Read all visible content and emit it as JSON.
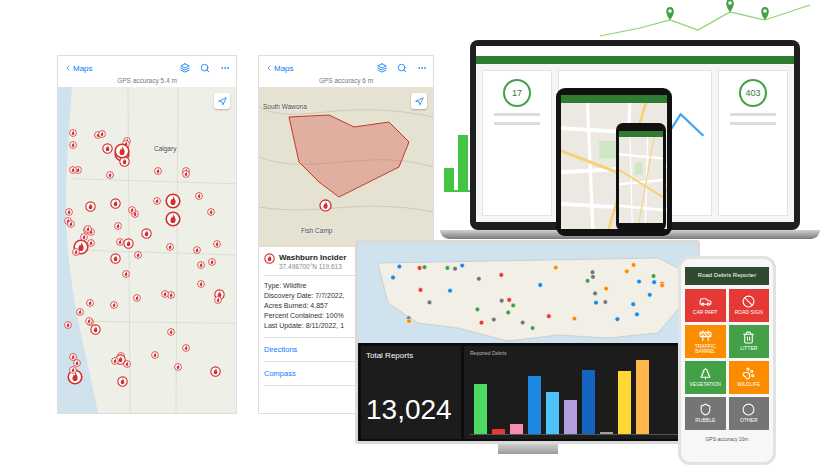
{
  "overview_screen": {
    "back": "Maps",
    "gps_accuracy": "GPS accuracy 5.4 m",
    "place_labels": [
      "Calgary"
    ]
  },
  "incident_screen": {
    "back": "Maps",
    "gps_accuracy": "GPS accuracy 6 m",
    "place_labels": [
      "South Wawona",
      "Fish Camp"
    ],
    "popup": {
      "title": "Washburn Incider",
      "coordinates": "37.498700°N 119.613",
      "fields": [
        "Type: Wildfire",
        "Discovery Date: 7/7/2022,",
        "Acres Burned: 4,857",
        "Percent Contained: 100%",
        "Last Update: 8/11/2022, 1"
      ]
    },
    "actions": [
      "Directions",
      "Compass"
    ]
  },
  "laptop_dashboard": {
    "stats": [
      "17",
      "403"
    ]
  },
  "debris_dashboard": {
    "total_label": "Total Reports",
    "total_value": "13,024",
    "chart": {
      "title": "Reported Debris",
      "bars": [
        {
          "value": 62,
          "color": "#4cd964"
        },
        {
          "value": 6,
          "color": "#e53935"
        },
        {
          "value": 12,
          "color": "#f48fb1"
        },
        {
          "value": 72,
          "color": "#1e88e5"
        },
        {
          "value": 52,
          "color": "#4fc3f7"
        },
        {
          "value": 42,
          "color": "#b39ddb"
        },
        {
          "value": 80,
          "color": "#1565c0"
        },
        {
          "value": 3,
          "color": "#9e9e9e"
        },
        {
          "value": 78,
          "color": "#fdd835"
        },
        {
          "value": 92,
          "color": "#ffb74d"
        }
      ]
    }
  },
  "debris_app": {
    "title": "Road Debris Reporter",
    "tiles": [
      {
        "label": "CAR PART",
        "color": "#e53935"
      },
      {
        "label": "ROAD SIGN",
        "color": "#e53935"
      },
      {
        "label": "TRAFFIC BARREL",
        "color": "#fb8c00"
      },
      {
        "label": "LITTER",
        "color": "#43a047"
      },
      {
        "label": "VEGETATION",
        "color": "#43a047"
      },
      {
        "label": "WILDLIFE",
        "color": "#fb8c00"
      },
      {
        "label": "RUBBLE",
        "color": "#757575"
      },
      {
        "label": "OTHER",
        "color": "#757575"
      }
    ],
    "footer": "GPS accuracy 10m"
  }
}
